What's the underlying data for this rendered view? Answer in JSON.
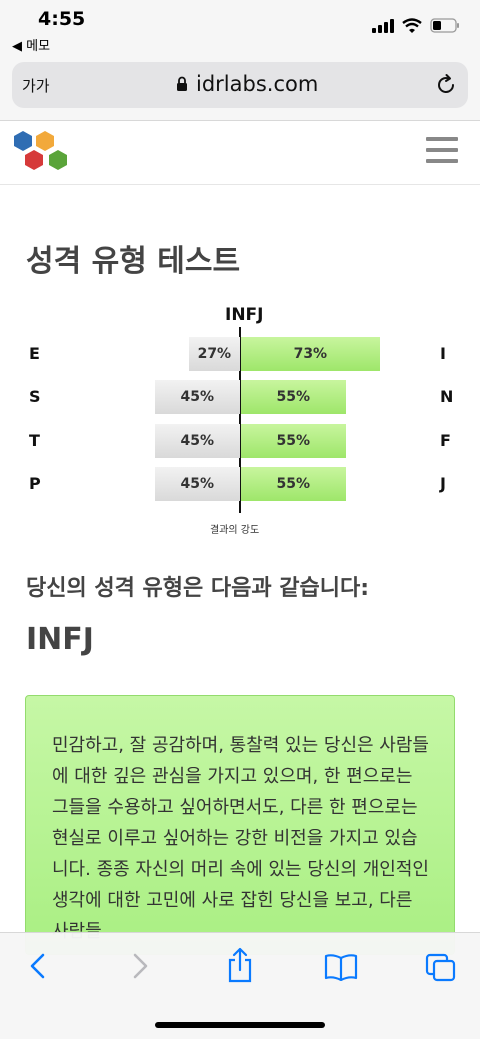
{
  "status": {
    "time": "4:55",
    "back_app": "◀ 메모"
  },
  "browser": {
    "aa_label": "가가",
    "url": "idrlabs.com"
  },
  "page": {
    "title": "성격 유형 테스트",
    "result_type": "INFJ",
    "chart_footer": "결과의 강도",
    "subheading": "당신의 성격 유형은 다음과 같습니다:",
    "type_heading": "INFJ",
    "description": "민감하고, 잘 공감하며, 통찰력 있는 당신은 사람들에 대한 깊은 관심을 가지고 있으며, 한 편으로는 그들을 수용하고 싶어하면서도, 다른 한 편으로는 현실로 이루고 싶어하는 강한 비전을 가지고 있습니다. 종종 자신의 머리 속에 있는 당신의 개인적인 생각에 대한 고민에 사로 잡힌 당신을 보고, 다른 사람들"
  },
  "chart_data": {
    "type": "bar",
    "title": "INFJ",
    "xlabel": "결과의 강도",
    "rows": [
      {
        "left_label": "E",
        "right_label": "I",
        "left_value": 27,
        "right_value": 73,
        "left_text": "27%",
        "right_text": "73%"
      },
      {
        "left_label": "S",
        "right_label": "N",
        "left_value": 45,
        "right_value": 55,
        "left_text": "45%",
        "right_text": "55%"
      },
      {
        "left_label": "T",
        "right_label": "F",
        "left_value": 45,
        "right_value": 55,
        "left_text": "45%",
        "right_text": "55%"
      },
      {
        "left_label": "P",
        "right_label": "J",
        "left_value": 45,
        "right_value": 55,
        "left_text": "45%",
        "right_text": "55%"
      }
    ]
  },
  "colors": {
    "accent_blue": "#0a7aff",
    "bar_green": "#9ee66a",
    "box_green": "#b5f28e"
  },
  "icons": [
    "signal-icon",
    "wifi-icon",
    "battery-icon",
    "lock-icon",
    "reload-icon",
    "menu-icon",
    "back-icon",
    "forward-icon",
    "share-icon",
    "bookmarks-icon",
    "tabs-icon"
  ]
}
